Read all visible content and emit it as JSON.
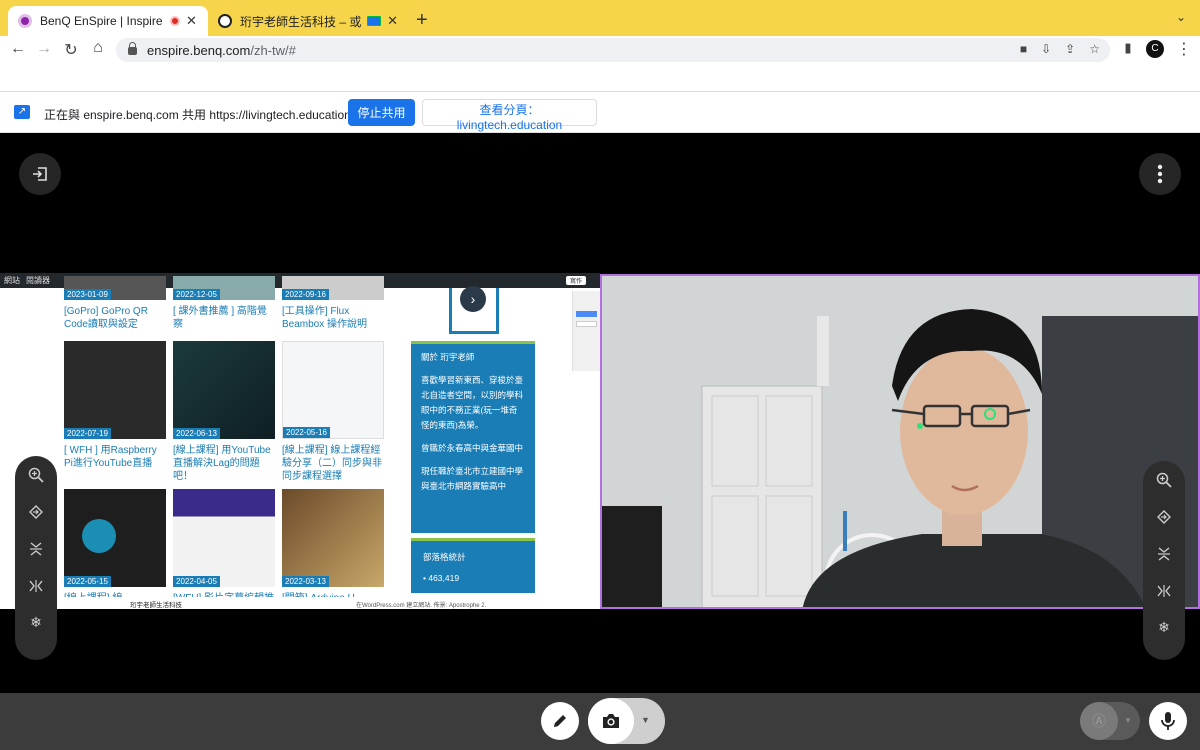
{
  "browser": {
    "tabs": [
      {
        "title": "BenQ EnSpire | Inspire peo",
        "active": true
      },
      {
        "title": "珩宇老師生活科技 – 或是水",
        "active": false
      }
    ],
    "new_tab_label": "+",
    "url_host": "enspire.benq.com",
    "url_path": "/zh-tw/#",
    "avatar_letter": "C"
  },
  "share_bar": {
    "text": "正在與 enspire.benq.com 共用 https://livingtech.education",
    "stop_label": "停止共用",
    "view_label": "查看分頁：livingtech.education"
  },
  "shared_site": {
    "top_items": [
      "網站",
      "閱讀器"
    ],
    "edit_label": "寫作",
    "cards": [
      {
        "date": "2023-01-09",
        "title": "[GoPro] GoPro QR Code讀取與設定"
      },
      {
        "date": "2022-12-05",
        "title": "[ 課外書推薦 ] 高階覺察"
      },
      {
        "date": "2022-09-16",
        "title": "[工具操作] Flux Beambox 操作說明"
      },
      {
        "date": "2022-07-19",
        "title": "[ WFH ] 用Raspberry Pi進行YouTube直播"
      },
      {
        "date": "2022-06-13",
        "title": "[線上課程] 用YouTube直播解決Lag的問題吧！"
      },
      {
        "date": "2022-05-16",
        "title": "[線上課程] 線上課程經驗分享（二）同步與非同步課程選擇"
      },
      {
        "date": "2022-05-15",
        "title": "[線上課程] 線"
      },
      {
        "date": "2022-04-05",
        "title": "[WFH] 影片字幕編輯推"
      },
      {
        "date": "2022-03-13",
        "title": "[開箱] Arduino U"
      }
    ],
    "about_title": "關於 珩宇老師",
    "about_p1": "喜歡學習新東西、穿梭於臺北自造者空間，以別的學科眼中的不務正業(玩一堆奇怪的東西)為榮。",
    "about_p2": "曾職於永春高中與金華國中",
    "about_p3": "現任職於臺北市立建國中學與臺北市網路實驗高中",
    "stats_title": "部落格統計",
    "stats_value": "463,419",
    "footer_site": "珩宇老師生活科技",
    "footer_credit": "在WordPress.com 建立網站. 佈景: Apostrophe 2."
  },
  "icons": {
    "exit": "exit-icon",
    "more": "more-vertical-icon",
    "zoom": "zoom-in-icon",
    "rotate": "rotate-icon",
    "flip_v": "flip-vertical-icon",
    "flip_h": "flip-horizontal-icon",
    "freeze": "freeze-icon",
    "pen": "pen-icon",
    "camera": "camera-icon",
    "ai": "ai-icon",
    "mic": "mic-icon"
  },
  "colors": {
    "tabstrip": "#f7d54a",
    "accent_blue": "#1a73e8",
    "site_blue": "#1a7db6",
    "camera_border": "#b36ee0",
    "bottom_bar": "#3c3c3c"
  }
}
